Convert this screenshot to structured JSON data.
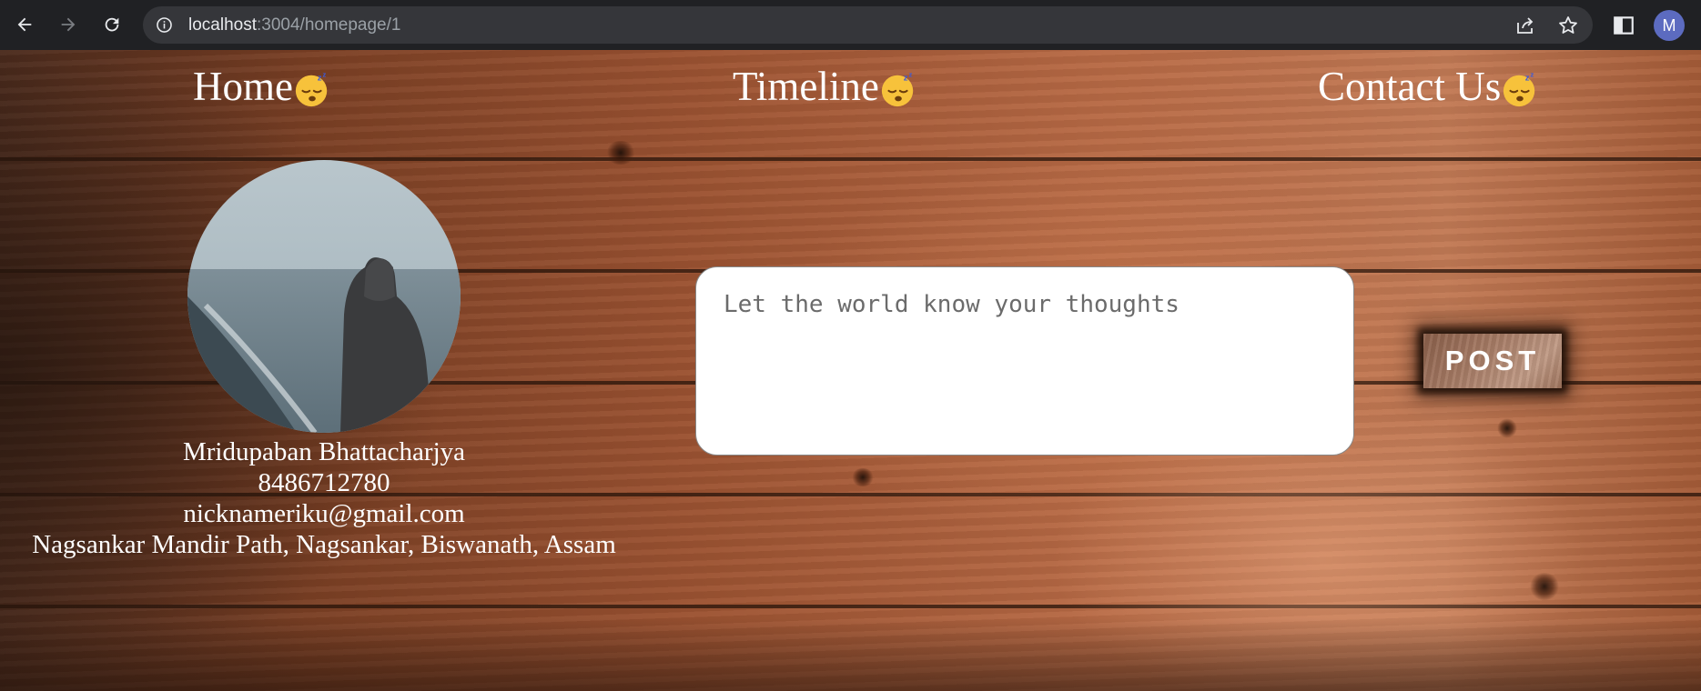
{
  "browser": {
    "url_host": "localhost",
    "url_rest": ":3004/homepage/1",
    "profile_initial": "M"
  },
  "nav": {
    "home": "Home",
    "timeline": "Timeline",
    "contact": "Contact Us",
    "emoji_icon": "sleeping-face-icon"
  },
  "profile": {
    "name": "Mridupaban Bhattacharjya",
    "phone": "8486712780",
    "email": "nicknameriku@gmail.com",
    "address": "Nagsankar Mandir Path, Nagsankar, Biswanath, Assam"
  },
  "composer": {
    "placeholder": "Let the world know your thoughts",
    "post_label": "POST"
  }
}
